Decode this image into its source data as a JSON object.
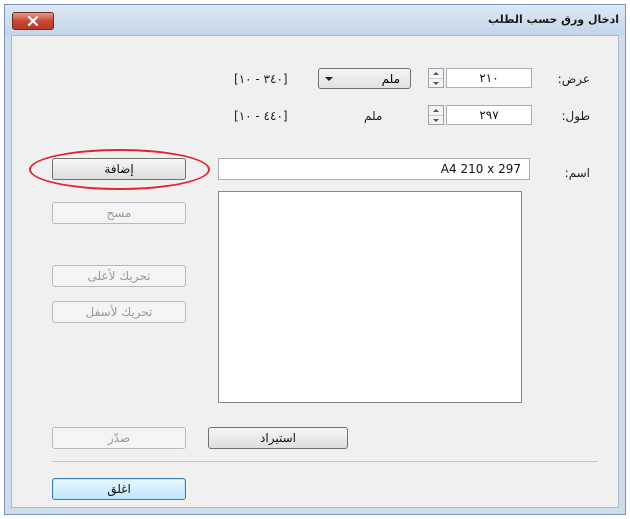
{
  "window": {
    "title": "ادخال ورق حسب الطلب"
  },
  "width": {
    "label": "عرض:",
    "value": "٢١٠",
    "unit": "ملم",
    "range": "[٣٤٠ - ١٠]"
  },
  "length": {
    "label": "طول:",
    "value": "٢٩٧",
    "unit": "ملم",
    "range": "[٤٤٠ - ١٠]"
  },
  "name": {
    "label": "اسم:",
    "value": "A4 210 x 297"
  },
  "buttons": {
    "add": "إضافة",
    "delete": "مسح",
    "move_up": "تحريك لأعلى",
    "move_down": "تحريك لأسفل",
    "export": "صدّر",
    "import": "استيراد",
    "close": "اغلق"
  },
  "icons": {
    "close": "close-x-icon",
    "spin": "spin-arrows-icon",
    "dropdown": "chevron-down-icon"
  },
  "colors": {
    "title_bg": "#c4d5ea",
    "client_bg": "#f0f0f0",
    "highlight": "#e0262c",
    "close_btn": "#c74a34"
  }
}
